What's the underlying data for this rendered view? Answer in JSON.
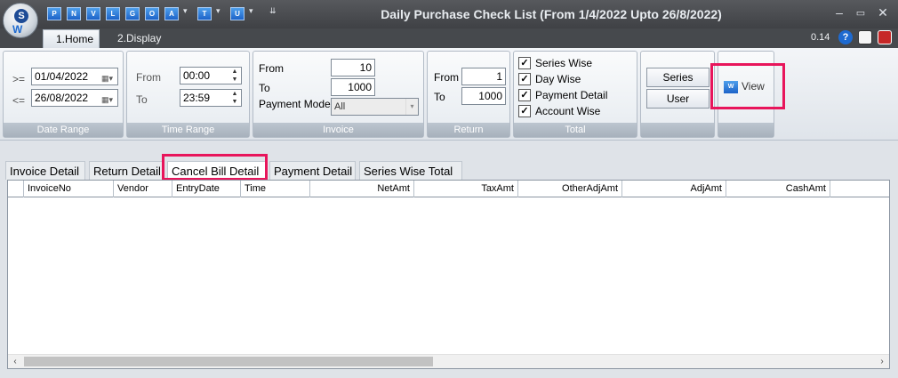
{
  "window": {
    "title": "Daily Purchase Check List (From 1/4/2022 Upto 26/8/2022)",
    "quick_access": [
      "P",
      "N",
      "V",
      "L",
      "G",
      "O",
      "A",
      "T",
      "U"
    ],
    "zoom": "0.14"
  },
  "ribbon_tabs": [
    "1.Home",
    "2.Display"
  ],
  "date_range": {
    "caption": "Date Range",
    "from_op": ">=",
    "to_op": "<=",
    "from_value": "01/04/2022",
    "to_value": "26/08/2022"
  },
  "time_range": {
    "caption": "Time Range",
    "from_label": "From",
    "to_label": "To",
    "from_value": "00:00",
    "to_value": "23:59"
  },
  "invoice": {
    "caption": "Invoice",
    "from_label": "From",
    "to_label": "To",
    "payment_mode_label": "Payment Mode",
    "from_value": "10",
    "to_value": "1000",
    "payment_mode_value": "All"
  },
  "return": {
    "caption": "Return",
    "from_label": "From",
    "to_label": "To",
    "from_value": "1",
    "to_value": "1000"
  },
  "total": {
    "caption": "Total",
    "options": [
      {
        "label": "Series Wise",
        "checked": true
      },
      {
        "label": "Day Wise",
        "checked": true
      },
      {
        "label": "Payment Detail",
        "checked": true
      },
      {
        "label": "Account Wise",
        "checked": true
      }
    ]
  },
  "buttons": {
    "series": "Series",
    "user": "User",
    "view": "View"
  },
  "content_tabs": [
    "Invoice Detail",
    "Return Detail",
    "Cancel Bill Detail",
    "Payment Detail",
    "Series Wise Total"
  ],
  "active_content_tab": "Cancel Bill Detail",
  "grid_columns": [
    "InvoiceNo",
    "Vendor",
    "EntryDate",
    "Time",
    "NetAmt",
    "TaxAmt",
    "OtherAdjAmt",
    "AdjAmt",
    "CashAmt"
  ],
  "colors": {
    "highlight": "#e8155b",
    "titlebar": "#46494d",
    "accent": "#1c63c8"
  }
}
